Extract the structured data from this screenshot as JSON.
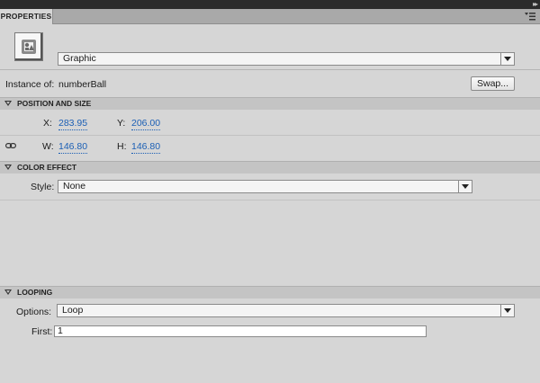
{
  "panel": {
    "tab_label": "PROPERTIES",
    "icons": {
      "collapse": "double-chevron-right-icon",
      "menu": "panel-menu-icon",
      "symbol": "graphic-symbol-icon",
      "link": "chain-link-icon"
    }
  },
  "instance": {
    "type_value": "Graphic",
    "instance_of_label": "Instance of:",
    "instance_name": "numberBall",
    "swap_label": "Swap..."
  },
  "position_size": {
    "title": "POSITION AND SIZE",
    "x_label": "X:",
    "x_value": "283.95",
    "y_label": "Y:",
    "y_value": "206.00",
    "w_label": "W:",
    "w_value": "146.80",
    "h_label": "H:",
    "h_value": "146.80"
  },
  "color_effect": {
    "title": "COLOR EFFECT",
    "style_label": "Style:",
    "style_value": "None"
  },
  "looping": {
    "title": "LOOPING",
    "options_label": "Options:",
    "options_value": "Loop",
    "first_label": "First:",
    "first_value": "1"
  },
  "colors": {
    "panel_bg": "#d6d6d6",
    "section_header_bg": "#c4c4c4",
    "link_value": "#1b5fb5",
    "top_strip": "#2b2b2b"
  }
}
